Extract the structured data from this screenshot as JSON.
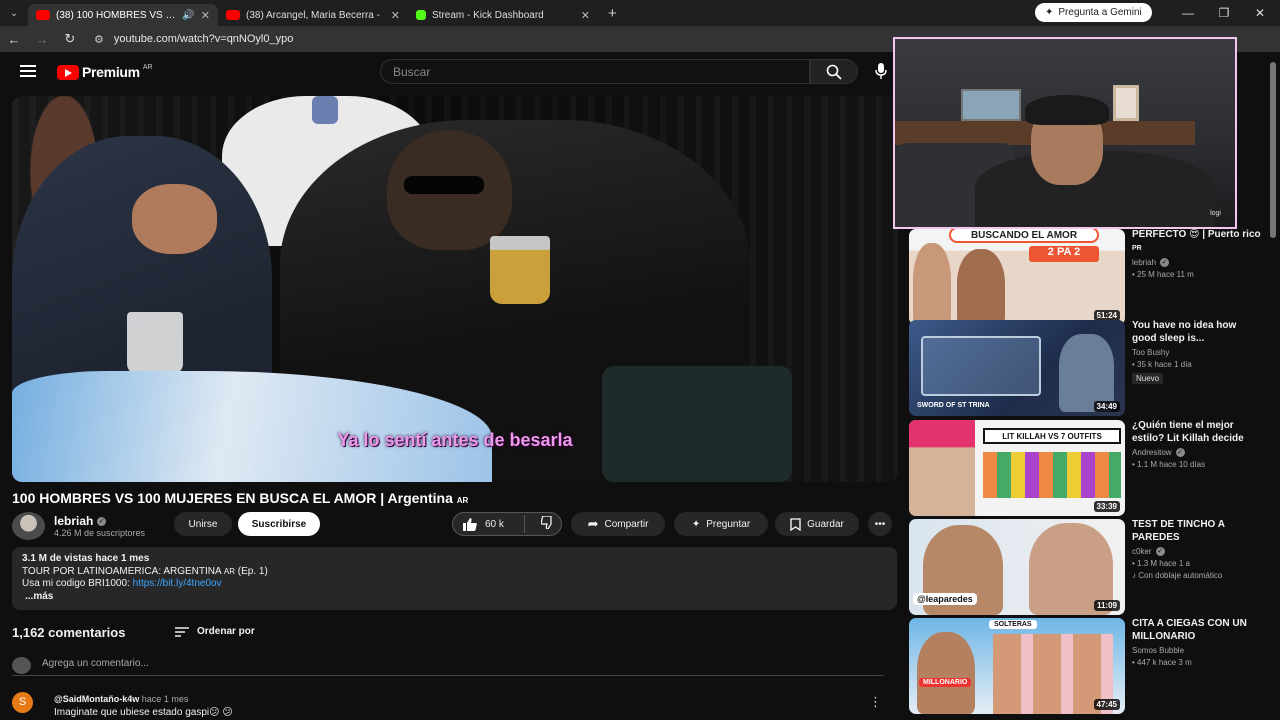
{
  "browser": {
    "tabs": [
      {
        "title": "(38) 100 HOMBRES VS 100",
        "active": true,
        "favicon_color": "#ff0000"
      },
      {
        "title": "(38) Arcangel, Maria Becerra -",
        "active": false,
        "favicon_color": "#ff0000"
      },
      {
        "title": "Stream - Kick Dashboard",
        "active": false,
        "favicon_color": "#53fc18"
      }
    ],
    "gemini_button": "Pregunta a Gemini",
    "url": "youtube.com/watch?v=qnNOyl0_ypo"
  },
  "youtube": {
    "logo_text": "Premium",
    "logo_country": "AR",
    "search_placeholder": "Buscar"
  },
  "video": {
    "subtitle": "Ya lo sentí antes de besarla",
    "title": "100 HOMBRES VS 100 MUJERES EN BUSCA EL AMOR | Argentina",
    "title_suffix": "AR",
    "channel": "lebriah",
    "subscribers": "4.26 M de suscriptores",
    "join_label": "Unirse",
    "subscribe_label": "Suscribirse",
    "likes": "60 k",
    "share_label": "Compartir",
    "ask_label": "Preguntar",
    "save_label": "Guardar"
  },
  "description": {
    "meta": "3.1 M de vistas  hace 1 mes",
    "line1_pre": "TOUR POR LATINOAMERICA: ARGENTINA ",
    "line1_ar": "AR",
    "line1_post": " (Ep. 1)",
    "line2_pre": "Usa mi codigo BRI1000: ",
    "line2_link": "https://bit.ly/4tne0ov",
    "more": "...más"
  },
  "comments": {
    "count": "1,162 comentarios",
    "sort_label": "Ordenar por",
    "add_placeholder": "Agrega un comentario...",
    "first": {
      "initial": "S",
      "author": "@SaidMontaño-k4w",
      "time": "hace 1 mes",
      "text": "Imaginate que ubiese estado gaspi😕 😕"
    }
  },
  "stream_overlay": {
    "label": "logi"
  },
  "recommendations": [
    {
      "title": "PERFECTO 😍 | Puerto rico",
      "title_suffix": "PR",
      "channel": "lebriah",
      "meta": "25 M  hace 11 m",
      "duration": "51:24",
      "thumb_text": "BUSCANDO EL AMOR",
      "thumb_sub": "2 PA 2"
    },
    {
      "title": "You have no idea how good sleep is...",
      "channel": "Too Bushy",
      "meta": "35 k  hace 1 día",
      "badge": "Nuevo",
      "duration": "34:49",
      "thumb_text": "SWORD OF ST TRINA"
    },
    {
      "title": "¿Quién tiene el mejor estilo? Lit Killah decide",
      "channel": "Andresitow",
      "meta": "1.1 M  hace 10 días",
      "duration": "33:39",
      "thumb_text": "LIT KILLAH VS 7 OUTFITS"
    },
    {
      "title": "TEST DE TINCHO A PAREDES",
      "channel": "c0ker",
      "meta": "1.3 M  hace 1 a",
      "dub": "Con doblaje automático",
      "duration": "11:09",
      "thumb_text": "@leaparedes"
    },
    {
      "title": "CITA A CIEGAS CON UN MILLONARIO",
      "channel": "Somos Bubble",
      "meta": "447 k  hace 3 m",
      "duration": "47:45",
      "thumb_text": "SOLTERAS",
      "thumb_sub": "MILLONARIO"
    }
  ]
}
